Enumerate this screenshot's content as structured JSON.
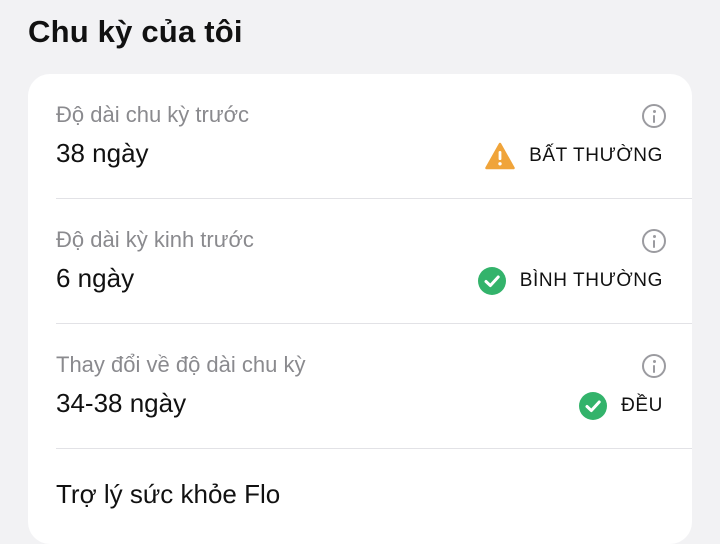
{
  "page": {
    "title": "Chu kỳ của tôi"
  },
  "rows": [
    {
      "label": "Độ dài chu kỳ trước",
      "value": "38 ngày",
      "status": "BẤT THƯỜNG",
      "status_icon": "warning-icon",
      "status_color": "#f0a43a"
    },
    {
      "label": "Độ dài kỳ kinh trước",
      "value": "6 ngày",
      "status": "BÌNH THƯỜNG",
      "status_icon": "check-icon",
      "status_color": "#33b36b"
    },
    {
      "label": "Thay đổi về độ dài chu kỳ",
      "value": "34-38 ngày",
      "status": "ĐỀU",
      "status_icon": "check-icon",
      "status_color": "#33b36b"
    }
  ],
  "assistant": {
    "label": "Trợ lý sức khỏe Flo"
  },
  "colors": {
    "background": "#f2f2f4",
    "card": "#ffffff",
    "secondary_text": "#8a8a8e"
  }
}
